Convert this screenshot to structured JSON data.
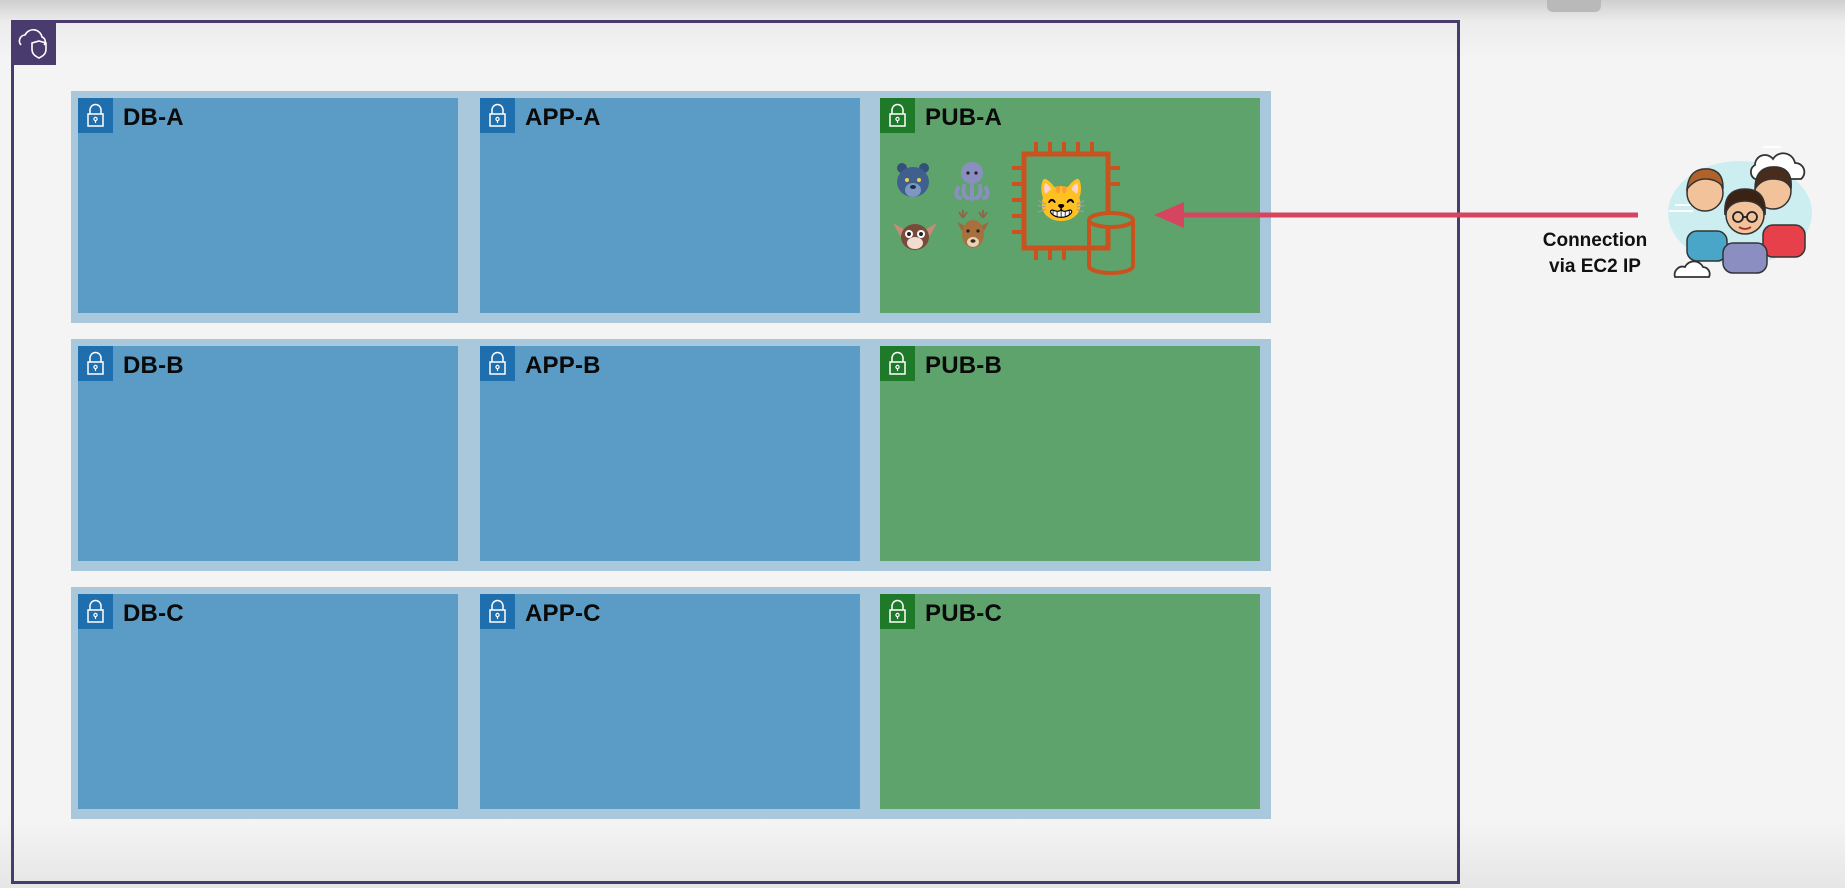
{
  "diagram": {
    "vpc": {
      "icon": "vpc-cloud-shield-icon",
      "border_color": "#4a3b6e"
    },
    "rows": [
      {
        "subnets": [
          {
            "label": "DB-A",
            "type": "private"
          },
          {
            "label": "APP-A",
            "type": "private"
          },
          {
            "label": "PUB-A",
            "type": "public"
          }
        ]
      },
      {
        "subnets": [
          {
            "label": "DB-B",
            "type": "private"
          },
          {
            "label": "APP-B",
            "type": "private"
          },
          {
            "label": "PUB-B",
            "type": "public"
          }
        ]
      },
      {
        "subnets": [
          {
            "label": "DB-C",
            "type": "private"
          },
          {
            "label": "APP-C",
            "type": "private"
          },
          {
            "label": "PUB-C",
            "type": "public"
          }
        ]
      }
    ],
    "pub_a_contents": {
      "ec2_icon": "ec2-instance-chip-icon",
      "cat_emoji": "😸",
      "db_icon": "database-cylinder-icon",
      "animals": [
        "panther-icon",
        "octopus-icon",
        "gremlin-icon",
        "deer-icon"
      ]
    },
    "connection": {
      "line1": "Connection",
      "line2": "via EC2 IP",
      "arrow_color": "#d64560",
      "users_icon": "users-group-cloud-icon"
    },
    "colors": {
      "private_subnet": "#5a9cc5",
      "public_subnet": "#5ea36c",
      "az_band": "#a9c8dc",
      "ec2_orange": "#c8531f"
    }
  }
}
